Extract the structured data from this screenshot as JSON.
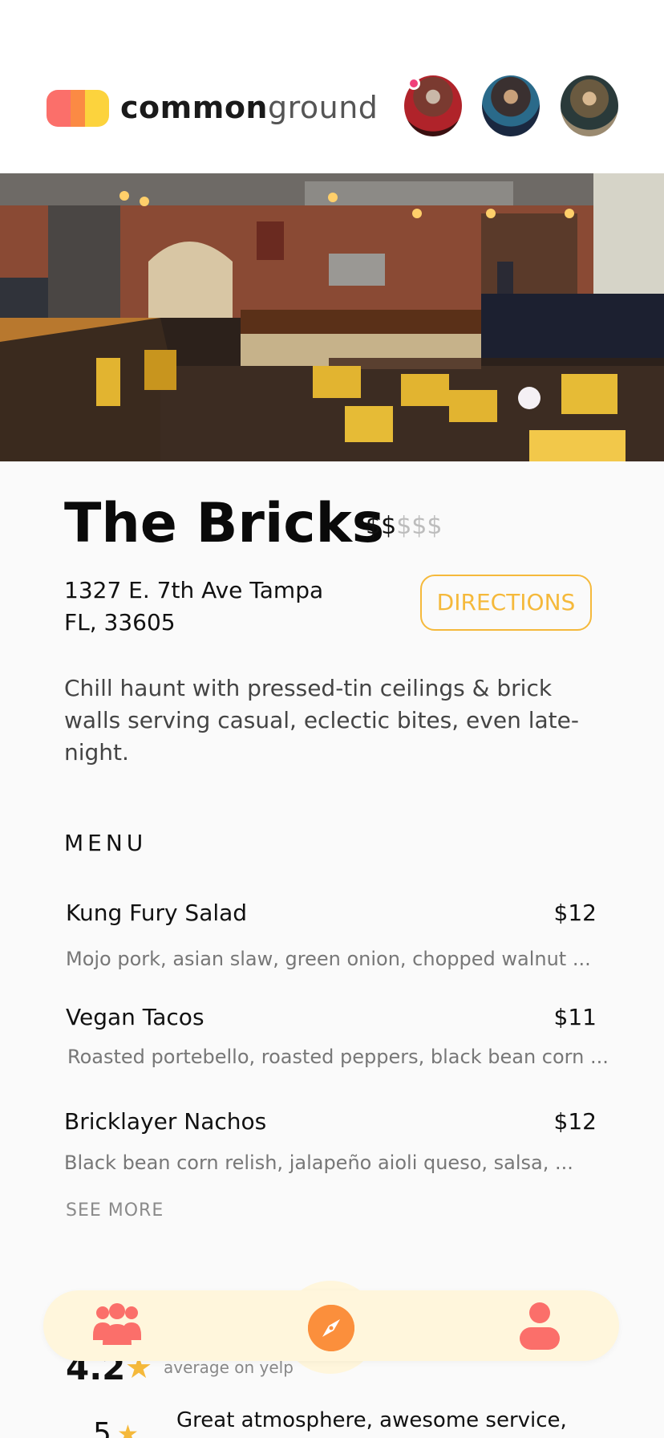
{
  "header": {
    "brand_bold": "common",
    "brand_light": "ground",
    "friends": [
      "friend-1",
      "friend-2",
      "friend-3"
    ]
  },
  "venue": {
    "name": "The Bricks",
    "price_active": "$$",
    "price_inactive": "$$$",
    "address_line1": "1327 E. 7th Ave Tampa",
    "address_line2": "FL, 33605",
    "directions_label": "DIRECTIONS",
    "description": "Chill haunt with pressed-tin ceilings & brick walls serving casual, eclectic bites, even late-night."
  },
  "menu": {
    "title": "MENU",
    "items": [
      {
        "name": "Kung Fury Salad",
        "price": "$12",
        "desc": "Mojo pork, asian slaw, green onion, chopped walnut ..."
      },
      {
        "name": "Vegan Tacos",
        "price": "$11",
        "desc": "Roasted portebello, roasted peppers, black bean corn ..."
      },
      {
        "name": "Bricklayer Nachos",
        "price": "$12",
        "desc": "Black bean corn relish, jalapeño aioli queso, salsa, ..."
      }
    ],
    "see_more": "SEE MORE"
  },
  "rating": {
    "value": "4.2",
    "label": "average on yelp",
    "review_score": "5",
    "review_text": "Great atmosphere, awesome service,"
  },
  "nav": {
    "left_icon": "group-icon",
    "center_icon": "compass-icon",
    "right_icon": "profile-icon",
    "accent": "#fb6f6a",
    "center_color": "#fb8f3c",
    "bar_color": "#fff6dc"
  },
  "colors": {
    "logo_red": "#fb6f6a",
    "logo_yellow": "#fcd33d",
    "directions": "#f5b93b",
    "star": "#f5b93b"
  }
}
